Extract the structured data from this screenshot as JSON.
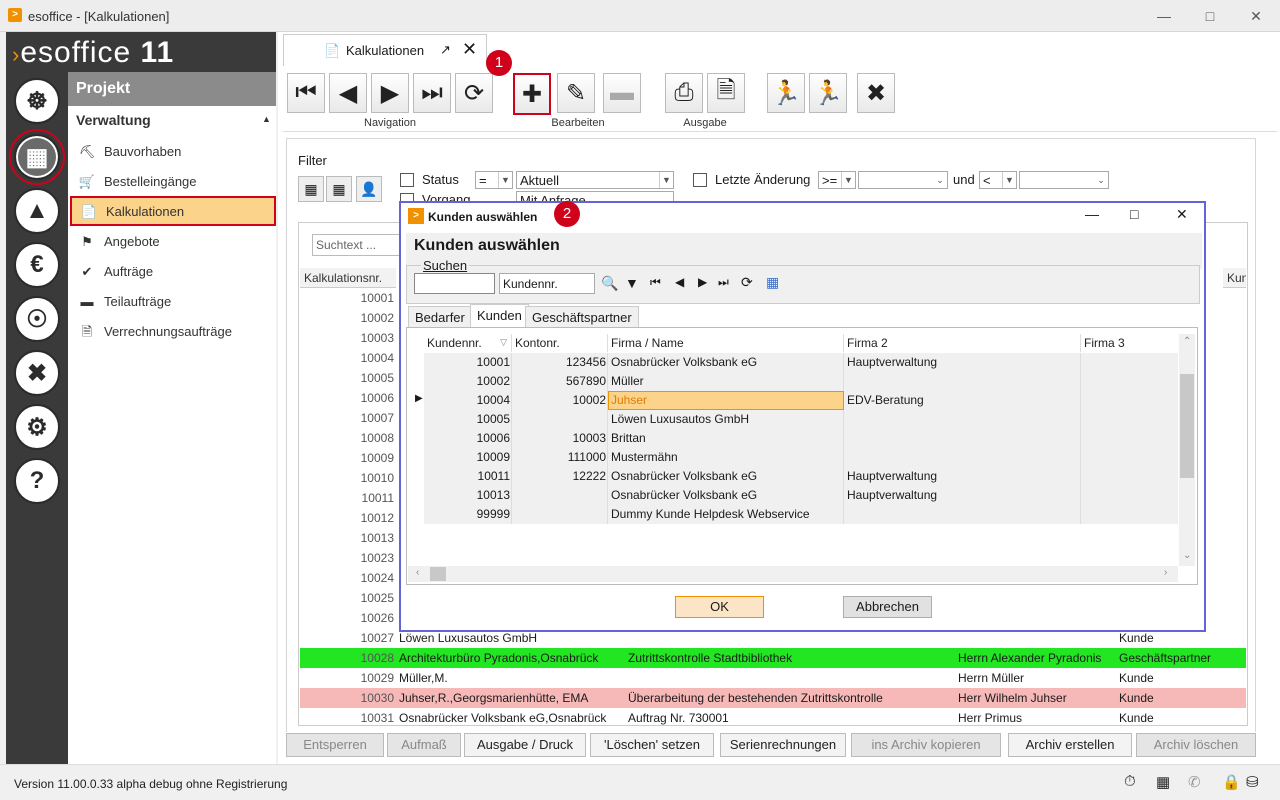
{
  "window": {
    "title": "esoffice - [Kalkulationen]",
    "app_icon": "esoffice-logo"
  },
  "brand": {
    "name": "esoffice",
    "version": "11"
  },
  "sidebar": {
    "header": "Projekt",
    "section": "Verwaltung",
    "items": [
      {
        "label": "Bauvorhaben",
        "icon": "excavator-icon"
      },
      {
        "label": "Bestelleingänge",
        "icon": "cart-icon"
      },
      {
        "label": "Kalkulationen",
        "icon": "documents-icon"
      },
      {
        "label": "Angebote",
        "icon": "tag-icon"
      },
      {
        "label": "Aufträge",
        "icon": "check-circle-icon"
      },
      {
        "label": "Teilaufträge",
        "icon": "split-icon"
      },
      {
        "label": "Verrechnungsaufträge",
        "icon": "invoice-icon"
      }
    ]
  },
  "tab": {
    "label": "Kalkulationen"
  },
  "ribbon": {
    "groups": {
      "navigation": "Navigation",
      "edit": "Bearbeiten",
      "output": "Ausgabe"
    },
    "badge1": "1",
    "badge2": "2"
  },
  "filter": {
    "label": "Filter",
    "status_label": "Status",
    "status_op": "=",
    "status_value": "Aktuell",
    "vorgang_label": "Vorgang",
    "vorgang_value": "Mit Anfrage",
    "last_change_label": "Letzte Änderung",
    "op1": ">=",
    "and_label": "und",
    "op2": "<"
  },
  "grid": {
    "search_placeholder": "Suchtext ...",
    "col_kalk": "Kalkulationsnr.",
    "col_kunde_right": "Kun",
    "rows_top": [
      "10001",
      "10002",
      "10003",
      "10004",
      "10005",
      "10006",
      "10007",
      "10008",
      "10009",
      "10010",
      "10011",
      "10012",
      "10013",
      "10023",
      "10024",
      "10025",
      "10026"
    ],
    "rows_bottom": [
      {
        "nr": "10027",
        "name": "Löwen Luxusautos GmbH",
        "desc": "",
        "contact": "",
        "type": "Kunde"
      },
      {
        "nr": "10028",
        "name": "Architekturbüro Pyradonis,Osnabrück",
        "desc": "Zutrittskontrolle Stadtbibliothek",
        "contact": "Herrn Alexander Pyradonis",
        "type": "Geschäftspartner"
      },
      {
        "nr": "10029",
        "name": "Müller,M.",
        "desc": "",
        "contact": "Herrn Müller",
        "type": "Kunde"
      },
      {
        "nr": "10030",
        "name": "Juhser,R.,Georgsmarienhütte, EMA",
        "desc": "Überarbeitung der bestehenden Zutrittskontrolle",
        "contact": "Herr Wilhelm Juhser",
        "type": "Kunde"
      },
      {
        "nr": "10031",
        "name": "Osnabrücker Volksbank eG,Osnabrück",
        "desc": "Auftrag Nr. 730001",
        "contact": "Herr Primus",
        "type": "Kunde"
      }
    ]
  },
  "bottom_buttons": [
    "Entsperren",
    "Aufmaß",
    "Ausgabe / Druck",
    "'Löschen' setzen",
    "Serienrechnungen",
    "ins Archiv kopieren",
    "Archiv erstellen",
    "Archiv löschen"
  ],
  "status": {
    "version": "Version 11.00.0.33 alpha debug",
    "registration": "ohne Registrierung"
  },
  "dialog": {
    "title": "Kunden auswählen",
    "heading": "Kunden auswählen",
    "search_label": "Suchen",
    "search_value": "",
    "search_field": "Kundennr.",
    "tabs": [
      "Bedarfer",
      "Kunden",
      "Geschäftspartner"
    ],
    "columns": [
      "Kundennr.",
      "Kontonr.",
      "Firma / Name",
      "Firma 2",
      "Firma 3"
    ],
    "rows": [
      {
        "k": "10001",
        "konto": "123456",
        "firma": "Osnabrücker Volksbank eG",
        "firma2": "Hauptverwaltung"
      },
      {
        "k": "10002",
        "konto": "567890",
        "firma": "Müller",
        "firma2": ""
      },
      {
        "k": "10004",
        "konto": "10002",
        "firma": "Juhser",
        "firma2": "EDV-Beratung"
      },
      {
        "k": "10005",
        "konto": "",
        "firma": "Löwen Luxusautos GmbH",
        "firma2": ""
      },
      {
        "k": "10006",
        "konto": "10003",
        "firma": "Brittan",
        "firma2": ""
      },
      {
        "k": "10009",
        "konto": "111000",
        "firma": "Mustermähn",
        "firma2": ""
      },
      {
        "k": "10011",
        "konto": "12222",
        "firma": "Osnabrücker Volksbank eG",
        "firma2": "Hauptverwaltung"
      },
      {
        "k": "10013",
        "konto": "",
        "firma": "Osnabrücker Volksbank eG",
        "firma2": "Hauptverwaltung"
      },
      {
        "k": "99999",
        "konto": "",
        "firma": "Dummy Kunde Helpdesk Webservice",
        "firma2": ""
      }
    ],
    "ok": "OK",
    "cancel": "Abbrechen"
  }
}
